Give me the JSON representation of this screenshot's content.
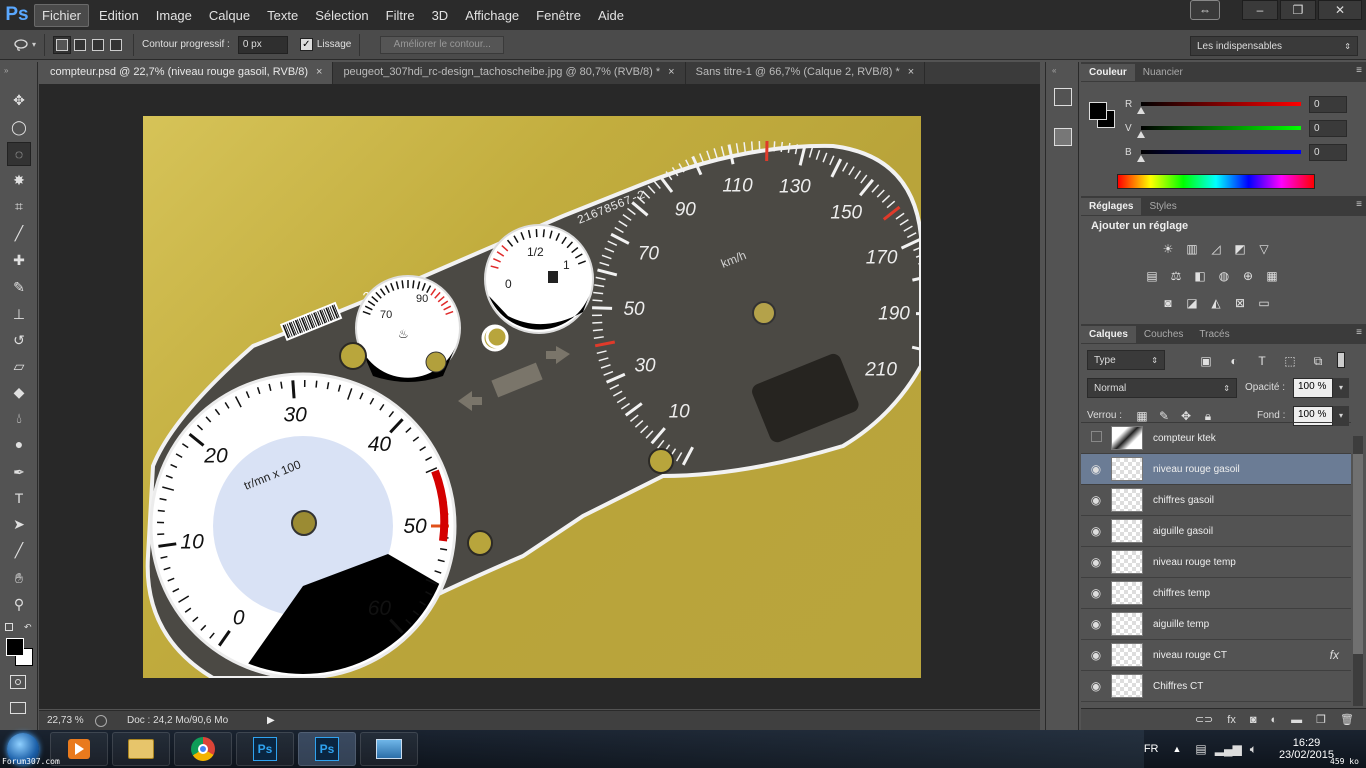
{
  "app": {
    "logo": "Ps"
  },
  "menu": [
    "Fichier",
    "Edition",
    "Image",
    "Calque",
    "Texte",
    "Sélection",
    "Filtre",
    "3D",
    "Affichage",
    "Fenêtre",
    "Aide"
  ],
  "window_controls": {
    "arrange": "⇔",
    "minimize": "–",
    "maximize": "❐",
    "close": "✕"
  },
  "options": {
    "feather_label": "Contour progressif :",
    "feather_value": "0 px",
    "antialias_label": "Lissage",
    "antialias_checked": true,
    "refine_edge": "Améliorer le contour...",
    "workspace": "Les indispensables"
  },
  "doc_tabs": [
    {
      "title": "compteur.psd @ 22,7% (niveau rouge gasoil, RVB/8)",
      "active": true
    },
    {
      "title": "peugeot_307hdi_rc-design_tachoscheibe.jpg @ 80,7% (RVB/8) *",
      "active": false
    },
    {
      "title": "Sans titre-1 @ 66,7% (Calque 2, RVB/8) *",
      "active": false
    }
  ],
  "tools": [
    "move-icon",
    "ellipse-marquee-icon",
    "lasso-icon",
    "magic-wand-icon",
    "crop-icon",
    "eyedropper-icon",
    "healing-brush-icon",
    "brush-icon",
    "stamp-icon",
    "history-brush-icon",
    "eraser-icon",
    "paint-bucket-icon",
    "blur-icon",
    "dodge-icon",
    "pen-icon",
    "type-icon",
    "path-selection-icon",
    "line-icon",
    "hand-icon",
    "zoom-icon"
  ],
  "artwork": {
    "serial": "21678567-2",
    "unit": "km/h",
    "speed_labels": [
      "10",
      "30",
      "50",
      "70",
      "90",
      "110",
      "130",
      "150",
      "170",
      "190",
      "210"
    ],
    "rpm_labels": [
      "0",
      "10",
      "20",
      "30",
      "40",
      "50",
      "60"
    ],
    "rpm_unit": "tr/mn x 100",
    "temp_labels": [
      "70",
      "90"
    ],
    "fuel_labels": [
      "0",
      "1/2",
      "1"
    ],
    "small_marker": "2"
  },
  "status": {
    "zoom": "22,73 %",
    "doc": "Doc : 24,2 Mo/90,6 Mo"
  },
  "color_panel": {
    "tabs": [
      "Couleur",
      "Nuancier"
    ],
    "channels": [
      {
        "label": "R",
        "value": "0"
      },
      {
        "label": "V",
        "value": "0"
      },
      {
        "label": "B",
        "value": "0"
      }
    ]
  },
  "adjustments_panel": {
    "tabs": [
      "Réglages",
      "Styles"
    ],
    "title": "Ajouter un réglage"
  },
  "layers_panel": {
    "tabs": [
      "Calques",
      "Couches",
      "Tracés"
    ],
    "filter": "Type",
    "blend_mode": "Normal",
    "opacity_label": "Opacité :",
    "opacity": "100 %",
    "lock_label": "Verrou :",
    "fill_label": "Fond :",
    "fill": "100 %",
    "layers": [
      {
        "name": "compteur ktek",
        "visible": false,
        "selected": false,
        "fx": ""
      },
      {
        "name": "niveau rouge gasoil",
        "visible": true,
        "selected": true,
        "fx": ""
      },
      {
        "name": "chiffres gasoil",
        "visible": true,
        "selected": false,
        "fx": ""
      },
      {
        "name": "aiguille gasoil",
        "visible": true,
        "selected": false,
        "fx": ""
      },
      {
        "name": "niveau rouge temp",
        "visible": true,
        "selected": false,
        "fx": ""
      },
      {
        "name": "chiffres temp",
        "visible": true,
        "selected": false,
        "fx": ""
      },
      {
        "name": "aiguille temp",
        "visible": true,
        "selected": false,
        "fx": ""
      },
      {
        "name": "niveau rouge CT",
        "visible": true,
        "selected": false,
        "fx": "fx"
      },
      {
        "name": "Chiffres CT",
        "visible": true,
        "selected": false,
        "fx": ""
      }
    ],
    "footer_icons": [
      "link-icon",
      "fx-icon",
      "mask-icon",
      "adjustment-icon",
      "folder-icon",
      "new-layer-icon",
      "trash-icon"
    ]
  },
  "taskbar": {
    "lang": "FR",
    "time": "16:29",
    "date": "23/02/2015",
    "watermark_left": "Forum307.com",
    "watermark_right": "459 ko"
  }
}
